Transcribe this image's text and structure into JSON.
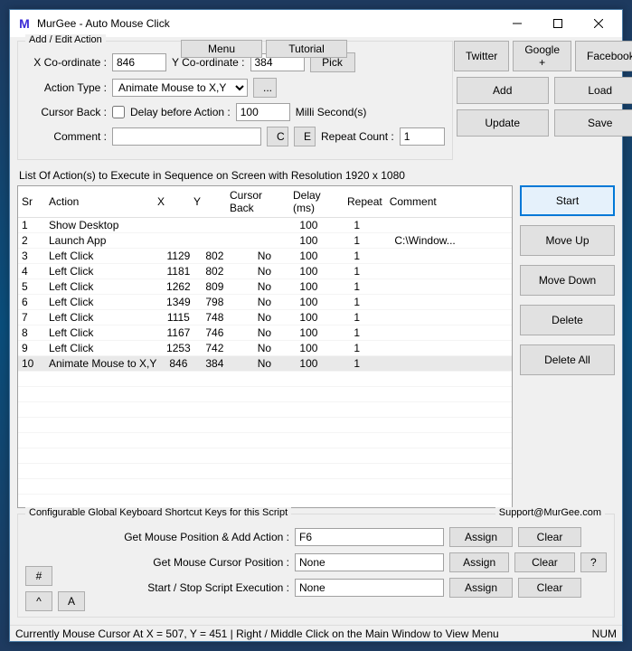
{
  "window": {
    "title": "MurGee - Auto Mouse Click"
  },
  "menu_tabs": {
    "menu": "Menu",
    "tutorial": "Tutorial"
  },
  "social": {
    "twitter": "Twitter",
    "google": "Google +",
    "facebook": "Facebook"
  },
  "edit": {
    "legend": "Add / Edit Action",
    "x_label": "X Co-ordinate :",
    "x_value": "846",
    "y_label": "Y Co-ordinate :",
    "y_value": "384",
    "pick": "Pick",
    "action_type_label": "Action Type :",
    "action_type_value": "Animate Mouse to X,Y",
    "more_btn": "...",
    "cursor_back_label": "Cursor Back :",
    "delay_label": "Delay before Action :",
    "delay_value": "100",
    "delay_units": "Milli Second(s)",
    "comment_label": "Comment :",
    "comment_value": "",
    "c_btn": "C",
    "e_btn": "E",
    "repeat_label": "Repeat Count :",
    "repeat_value": "1"
  },
  "mainbtns": {
    "add": "Add",
    "load": "Load",
    "update": "Update",
    "save": "Save"
  },
  "list_label": "List Of Action(s) to Execute in Sequence on Screen with Resolution 1920 x 1080",
  "columns": {
    "sr": "Sr",
    "action": "Action",
    "x": "X",
    "y": "Y",
    "cursor_back": "Cursor Back",
    "delay": "Delay (ms)",
    "repeat": "Repeat",
    "comment": "Comment"
  },
  "rows": [
    {
      "sr": "1",
      "action": "Show Desktop",
      "x": "",
      "y": "",
      "cb": "",
      "delay": "100",
      "repeat": "1",
      "comment": ""
    },
    {
      "sr": "2",
      "action": "Launch App",
      "x": "",
      "y": "",
      "cb": "",
      "delay": "100",
      "repeat": "1",
      "comment": "C:\\Window..."
    },
    {
      "sr": "3",
      "action": "Left Click",
      "x": "1129",
      "y": "802",
      "cb": "No",
      "delay": "100",
      "repeat": "1",
      "comment": ""
    },
    {
      "sr": "4",
      "action": "Left Click",
      "x": "1181",
      "y": "802",
      "cb": "No",
      "delay": "100",
      "repeat": "1",
      "comment": ""
    },
    {
      "sr": "5",
      "action": "Left Click",
      "x": "1262",
      "y": "809",
      "cb": "No",
      "delay": "100",
      "repeat": "1",
      "comment": ""
    },
    {
      "sr": "6",
      "action": "Left Click",
      "x": "1349",
      "y": "798",
      "cb": "No",
      "delay": "100",
      "repeat": "1",
      "comment": ""
    },
    {
      "sr": "7",
      "action": "Left Click",
      "x": "1115",
      "y": "748",
      "cb": "No",
      "delay": "100",
      "repeat": "1",
      "comment": ""
    },
    {
      "sr": "8",
      "action": "Left Click",
      "x": "1167",
      "y": "746",
      "cb": "No",
      "delay": "100",
      "repeat": "1",
      "comment": ""
    },
    {
      "sr": "9",
      "action": "Left Click",
      "x": "1253",
      "y": "742",
      "cb": "No",
      "delay": "100",
      "repeat": "1",
      "comment": ""
    },
    {
      "sr": "10",
      "action": "Animate Mouse to X,Y",
      "x": "846",
      "y": "384",
      "cb": "No",
      "delay": "100",
      "repeat": "1",
      "comment": ""
    }
  ],
  "sidebtns": {
    "start": "Start",
    "moveup": "Move Up",
    "movedown": "Move Down",
    "delete": "Delete",
    "deleteall": "Delete All"
  },
  "shortcuts": {
    "legend": "Configurable Global Keyboard Shortcut Keys for this Script",
    "support": "Support@MurGee.com",
    "row1_label": "Get Mouse Position & Add Action :",
    "row1_value": "F6",
    "row2_label": "Get Mouse Cursor Position :",
    "row2_value": "None",
    "row3_label": "Start / Stop Script Execution :",
    "row3_value": "None",
    "assign": "Assign",
    "clear": "Clear",
    "help": "?",
    "hash": "#",
    "caret": "^",
    "a": "A"
  },
  "status": {
    "text": "Currently Mouse Cursor At X = 507, Y = 451 | Right / Middle Click on the Main Window to View Menu",
    "num": "NUM"
  }
}
